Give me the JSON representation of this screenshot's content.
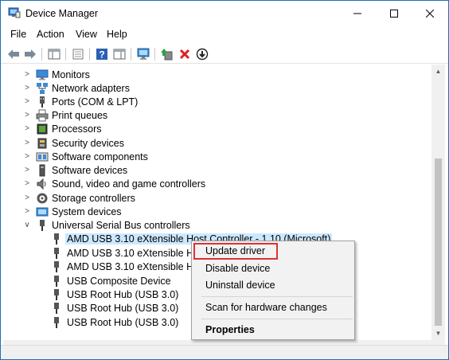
{
  "window": {
    "title": "Device Manager"
  },
  "menubar": {
    "items": [
      "File",
      "Action",
      "View",
      "Help"
    ]
  },
  "toolbar": {
    "buttons": [
      "back-icon",
      "forward-icon",
      "properties-icon",
      "help-icon",
      "monitor-icon",
      "update-driver-icon",
      "uninstall-icon",
      "download-icon"
    ]
  },
  "tree": {
    "categories": [
      "Monitors",
      "Network adapters",
      "Ports (COM & LPT)",
      "Print queues",
      "Processors",
      "Security devices",
      "Software components",
      "Software devices",
      "Sound, video and game controllers",
      "Storage controllers",
      "System devices",
      "Universal Serial Bus controllers"
    ],
    "usb_children": [
      "AMD USB 3.10 eXtensible Host Controller - 1.10 (Microsoft)",
      "AMD USB 3.10 eXtensible Ho",
      "AMD USB 3.10 eXtensible Ho",
      "USB Composite Device",
      "USB Root Hub (USB 3.0)",
      "USB Root Hub (USB 3.0)",
      "USB Root Hub (USB 3.0)"
    ]
  },
  "context_menu": {
    "update_driver": "Update driver",
    "disable_device": "Disable device",
    "uninstall_device": "Uninstall device",
    "scan": "Scan for hardware changes",
    "properties": "Properties"
  },
  "colors": {
    "selection": "#cce8ff",
    "highlight_box": "#e03131",
    "window_border": "#1c6fb9"
  }
}
